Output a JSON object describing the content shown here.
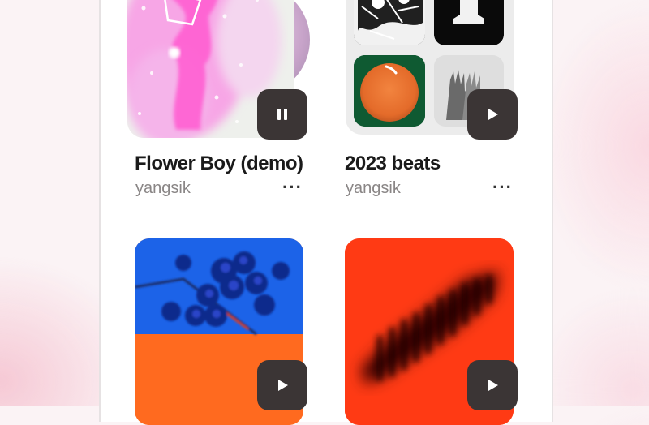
{
  "cards": [
    {
      "title": "Flower Boy (demo)",
      "artist": "yangsik",
      "more": "···",
      "button_icon": "pause-icon"
    },
    {
      "title": "2023 beats",
      "artist": "yangsik",
      "more": "···",
      "button_icon": "play-icon"
    },
    {
      "title": "",
      "artist": "",
      "button_icon": "play-icon"
    },
    {
      "title": "",
      "artist": "",
      "button_icon": "play-icon"
    }
  ],
  "colors": {
    "button_bg": "#3b3535",
    "title": "#1a1a1a",
    "artist": "#8a8686"
  }
}
